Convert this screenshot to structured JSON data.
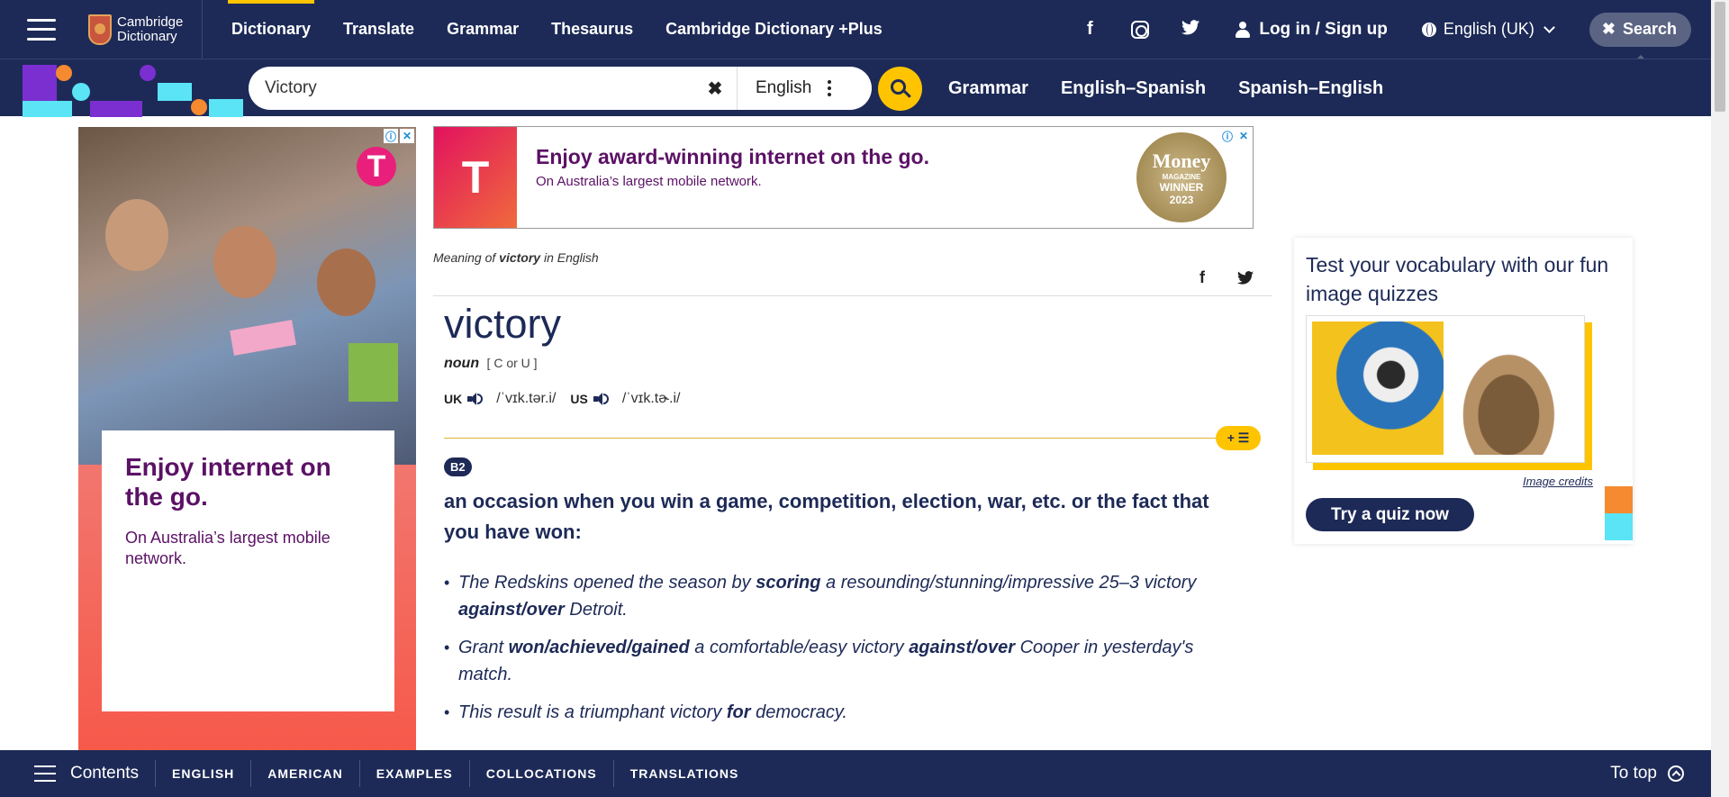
{
  "nav": {
    "logo_line1": "Cambridge",
    "logo_line2": "Dictionary",
    "links": [
      "Dictionary",
      "Translate",
      "Grammar",
      "Thesaurus",
      "Cambridge Dictionary +Plus"
    ],
    "social_facebook": "f",
    "social_twitter": "🐦",
    "login_label": "Log in / Sign up",
    "language_label": "English (UK)",
    "search_label": "Search",
    "accent_color": "#fec400",
    "bg_color": "#1d2a57"
  },
  "searchbar": {
    "query": "Victory",
    "clear_icon": "✖",
    "dictionary_select": "English",
    "sublinks": [
      "Grammar",
      "English–Spanish",
      "Spanish–English"
    ]
  },
  "left_ad": {
    "info_icon": "ⓘ",
    "close_icon": "✕",
    "brand_glyph": "T",
    "headline": "Enjoy internet on the go.",
    "body": "On Australia’s largest mobile network."
  },
  "banner_ad": {
    "brand_glyph": "T",
    "headline": "Enjoy award-winning internet on the go.",
    "body": "On Australia’s largest mobile network.",
    "award_title": "Money",
    "award_sub": "MAGAZINE",
    "award_winner": "WINNER",
    "award_year": "2023",
    "info_icon": "ⓘ",
    "close_icon": "✕"
  },
  "entry": {
    "meaning_prefix": "Meaning of",
    "meaning_word": "victory",
    "meaning_suffix": "in English",
    "headword": "victory",
    "pos": "noun",
    "grammar": "[ C or U ]",
    "uk_label": "UK",
    "uk_ipa": "/ˈvɪk.tər.i/",
    "us_label": "US",
    "us_ipa": "/ˈvɪk.tɚ.i/",
    "add_to_list": "+ ☰",
    "level": "B2",
    "definition": "an occasion when you win a game, competition, election, war, etc. or the fact that you have won:",
    "examples": [
      [
        {
          "t": "The Redskins opened the season by ",
          "b": false
        },
        {
          "t": "scoring",
          "b": true
        },
        {
          "t": " a resounding/stunning/impressive 25–3 victory ",
          "b": false
        },
        {
          "t": "against/over",
          "b": true
        },
        {
          "t": " Detroit.",
          "b": false
        }
      ],
      [
        {
          "t": "Grant ",
          "b": false
        },
        {
          "t": "won/achieved/gained",
          "b": true
        },
        {
          "t": " a comfortable/easy victory ",
          "b": false
        },
        {
          "t": "against/over",
          "b": true
        },
        {
          "t": " Cooper in yesterday's match.",
          "b": false
        }
      ],
      [
        {
          "t": "This result is a triumphant victory ",
          "b": false
        },
        {
          "t": "for",
          "b": true
        },
        {
          "t": " democracy.",
          "b": false
        }
      ]
    ]
  },
  "quiz": {
    "title": "Test your vocabulary with our fun image quizzes",
    "credits": "Image credits",
    "button": "Try a quiz now"
  },
  "bottombar": {
    "contents_label": "Contents",
    "tabs": [
      "ENGLISH",
      "AMERICAN",
      "EXAMPLES",
      "COLLOCATIONS",
      "TRANSLATIONS"
    ],
    "to_top": "To top"
  }
}
